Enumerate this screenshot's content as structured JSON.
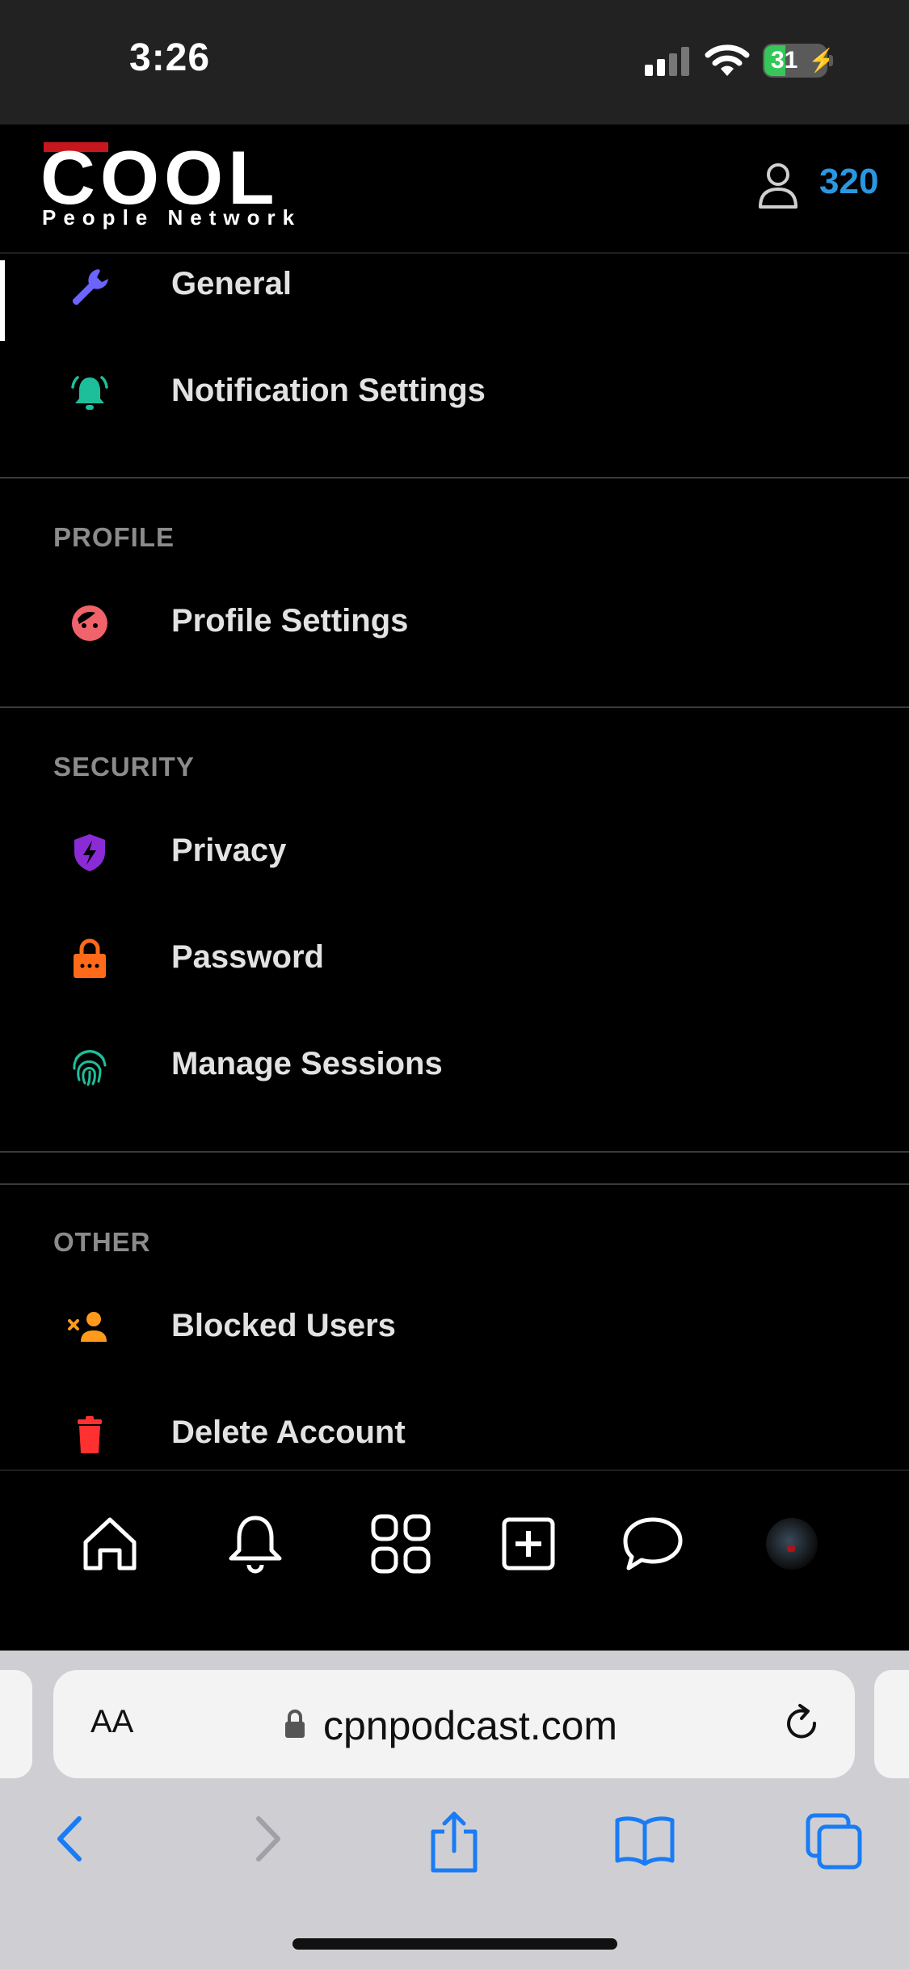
{
  "status": {
    "time": "3:26",
    "battery": "31"
  },
  "header": {
    "logo_main": "COOL",
    "logo_sub": "People Network",
    "points": "320",
    "accent_color": "#2a97e0",
    "logo_red": "#c8161d"
  },
  "menu": {
    "general": "General",
    "notification_settings": "Notification Settings",
    "section_profile": "PROFILE",
    "profile_settings": "Profile Settings",
    "section_security": "SECURITY",
    "privacy": "Privacy",
    "password": "Password",
    "manage_sessions": "Manage Sessions",
    "section_other": "OTHER",
    "blocked_users": "Blocked Users",
    "delete_account": "Delete Account"
  },
  "icons": {
    "general": "wrench-icon",
    "notifications": "bell-ringing-icon",
    "profile": "face-icon",
    "privacy": "shield-bolt-icon",
    "password": "lock-bag-icon",
    "sessions": "fingerprint-icon",
    "blocked": "user-x-icon",
    "delete": "trash-icon"
  },
  "bottom_nav": [
    "home-icon",
    "bell-icon",
    "apps-grid-icon",
    "add-post-icon",
    "chat-icon",
    "avatar"
  ],
  "browser": {
    "aa_label": "AA",
    "url": "cpnpodcast.com"
  }
}
